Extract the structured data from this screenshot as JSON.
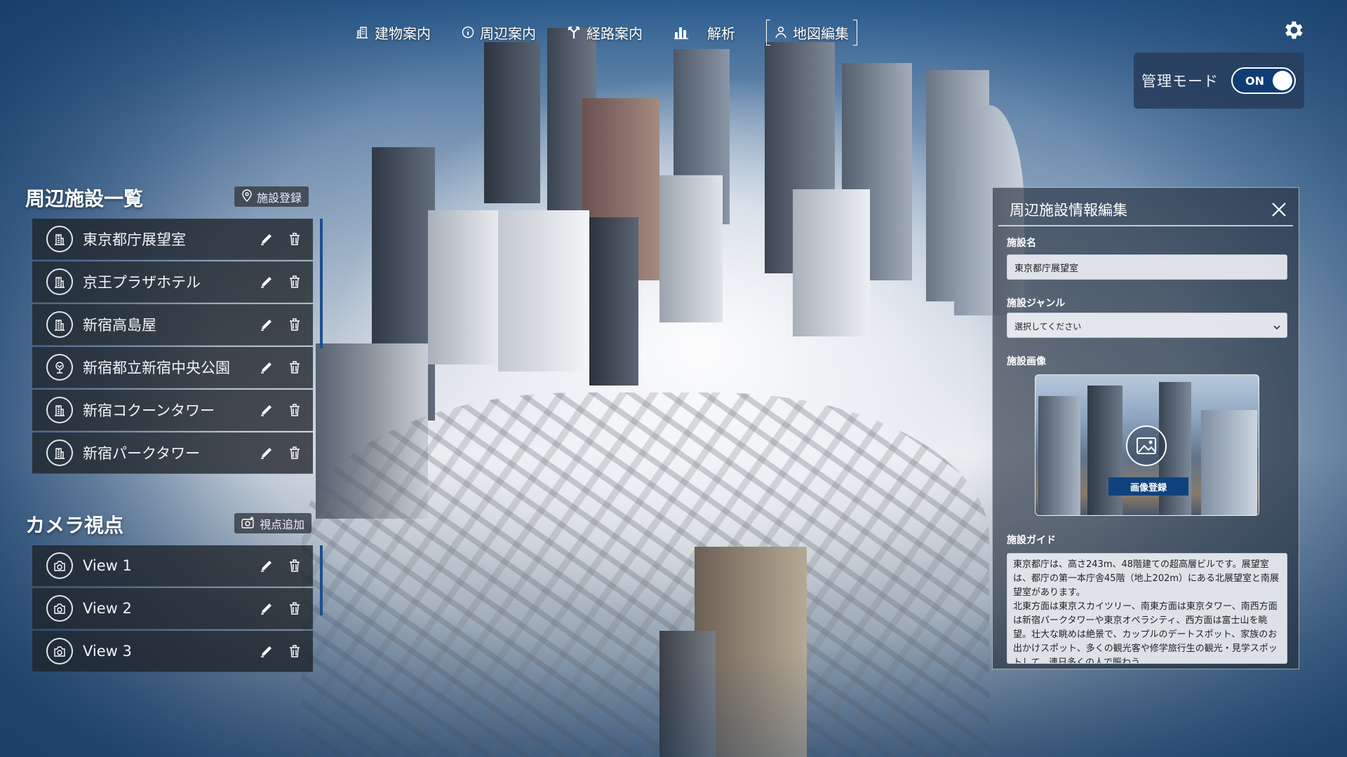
{
  "nav": {
    "items": [
      {
        "label": "建物案内",
        "icon": "building-icon"
      },
      {
        "label": "周辺案内",
        "icon": "info-icon"
      },
      {
        "label": "経路案内",
        "icon": "route-icon"
      },
      {
        "label": "解析",
        "icon": "analysis-icon"
      },
      {
        "label": "地図編集",
        "icon": "map-edit-icon"
      }
    ]
  },
  "admin": {
    "label": "管理モード",
    "toggle_state": "ON"
  },
  "facilities": {
    "title": "周辺施設一覧",
    "add_button": "施設登録",
    "items": [
      {
        "label": "東京都庁展望室",
        "icon": "building-icon"
      },
      {
        "label": "京王プラザホテル",
        "icon": "building-icon"
      },
      {
        "label": "新宿高島屋",
        "icon": "building-icon"
      },
      {
        "label": "新宿都立新宿中央公園",
        "icon": "park-icon"
      },
      {
        "label": "新宿コクーンタワー",
        "icon": "building-icon"
      },
      {
        "label": "新宿パークタワー",
        "icon": "building-icon"
      }
    ]
  },
  "camera": {
    "title": "カメラ視点",
    "add_button": "視点追加",
    "items": [
      {
        "label": "View 1"
      },
      {
        "label": "View 2"
      },
      {
        "label": "View 3"
      }
    ]
  },
  "edit": {
    "title": "周辺施設情報編集",
    "name_label": "施設名",
    "name_value": "東京都庁展望室",
    "genre_label": "施設ジャンル",
    "genre_value": "選択してください",
    "image_label": "施設画像",
    "image_button": "画像登録",
    "guide_label": "施設ガイド",
    "guide_text": "東京都庁は、高さ243m、48階建ての超高層ビルです。展望室は、都庁の第一本庁舎45階（地上202m）にある北展望室と南展望室があります。\n北東方面は東京スカイツリー、南東方面は東京タワー、南西方面は新宿パークタワーや東京オペラシティ、西方面は富士山を眺望。壮大な眺めは絶景で、カップルのデートスポット、家族のお出かけスポット、多くの観光客や修学旅行生の観光・見学スポットして、連日多くの人で賑わう。"
  }
}
